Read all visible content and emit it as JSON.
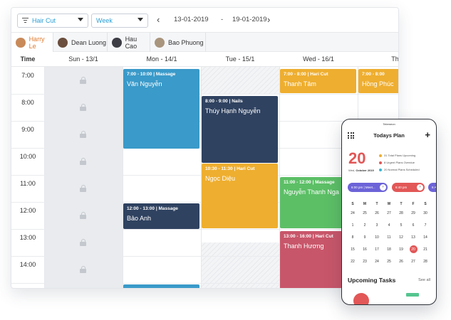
{
  "toolbar": {
    "service_filter": "Hair Cut",
    "view_select": "Week",
    "date_from": "13-01-2019",
    "date_separator": "-",
    "date_to": "19-01-2019",
    "prev_icon": "chevron-left-icon",
    "next_icon": "chevron-right-icon"
  },
  "staff": [
    {
      "name": "Harry Le",
      "active": true
    },
    {
      "name": "Dean Luong",
      "active": false
    },
    {
      "name": "Hau Cao",
      "active": false
    },
    {
      "name": "Bao Phuong",
      "active": false
    }
  ],
  "columns": {
    "time": "Time",
    "days": [
      "Sun - 13/1",
      "Mon - 14/1",
      "Tue - 15/1",
      "Wed - 16/1",
      "Thu"
    ]
  },
  "times": [
    "7:00",
    "8:00",
    "9:00",
    "10:00",
    "11:00",
    "12:00",
    "13:00",
    "14:00"
  ],
  "events": [
    {
      "meta": "7:00 - 10:00 | Massage",
      "name": "Văn Nguyễn",
      "color": "#3a9ac9"
    },
    {
      "meta": "12:00 - 13:00 | Massage",
      "name": "Bảo Anh",
      "color": "#2f4260"
    },
    {
      "meta": "8:00 - 9:00 | Nails",
      "name": "Thúy Hạnh Nguyễn",
      "color": "#2f4260"
    },
    {
      "meta": "10:30 - 11:30 | Hari Cut",
      "name": "Ngọc Diệu",
      "color": "#eeae2f"
    },
    {
      "meta": "7:00 - 8:00 | Hari Cut",
      "name": "Thanh Tâm",
      "color": "#eeae2f"
    },
    {
      "meta": "11:00 - 12:00 | Massage",
      "name": "Nguyễn Thanh Nga",
      "color": "#5cbf66"
    },
    {
      "meta": "13:00 - 16:00 | Hari Cut",
      "name": "Thanh Hương",
      "color": "#c8566a"
    },
    {
      "meta": "7:00 - 8:00",
      "name": "Hồng Phúc",
      "color": "#eeae2f"
    }
  ],
  "phone": {
    "status_center": "Telemeon",
    "title": "Todays Plan",
    "big_day": "20",
    "date_prefix": "Wed,",
    "date_rest": "October 2019",
    "stats": [
      {
        "text": "31 Total Plans Upcoming",
        "color": "#eeae2f"
      },
      {
        "text": "8 Urgent Plans Overdue",
        "color": "#e25757"
      },
      {
        "text": "20 Normal Plans Scheduled",
        "color": "#35b6d3"
      }
    ],
    "pills": [
      {
        "text": "6:00 pm | Meet...",
        "color": "#6c63d8"
      },
      {
        "text": "6:40 pm",
        "color": "#e25757"
      },
      {
        "text": "8 A",
        "color": "#6c63d8"
      }
    ],
    "weekdays": [
      "S",
      "M",
      "T",
      "W",
      "T",
      "F",
      "S"
    ],
    "calendar_rows": [
      [
        "24",
        "25",
        "26",
        "27",
        "28",
        "29",
        "30"
      ],
      [
        "1",
        "2",
        "3",
        "4",
        "5",
        "6",
        "7"
      ],
      [
        "8",
        "9",
        "10",
        "11",
        "12",
        "13",
        "14"
      ],
      [
        "15",
        "16",
        "17",
        "18",
        "19",
        "20",
        "21"
      ],
      [
        "22",
        "23",
        "24",
        "25",
        "26",
        "27",
        "28"
      ]
    ],
    "today": "20",
    "upcoming_title": "Upcoming Tasks",
    "see_all": "See all"
  }
}
